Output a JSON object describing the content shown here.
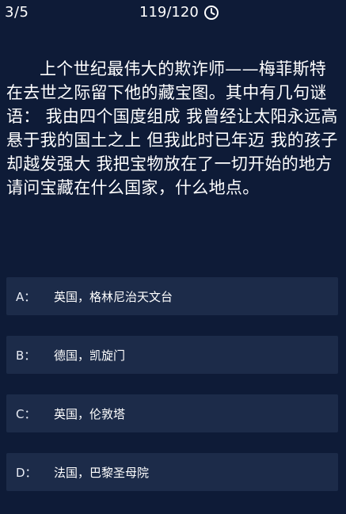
{
  "header": {
    "progress": "3/5",
    "timer": "119/120",
    "timer_icon": "clock-icon"
  },
  "question": {
    "text": "上个世纪最伟大的欺诈师——梅菲斯特在去世之际留下他的藏宝图。其中有几句谜语： 我由四个国度组成 我曾经让太阳永远高悬于我的国土之上 但我此时已年迈 我的孩子却越发强大 我把宝物放在了一切开始的地方 请问宝藏在什么国家，什么地点。"
  },
  "options": [
    {
      "key": "A：",
      "text": "英国，格林尼治天文台"
    },
    {
      "key": "B：",
      "text": "德国，凯旋门"
    },
    {
      "key": "C：",
      "text": "英国，伦敦塔"
    },
    {
      "key": "D：",
      "text": "法国，巴黎圣母院"
    }
  ],
  "colors": {
    "background": "#0e1b37",
    "option_background": "#1c2b49",
    "text": "#ffffff"
  }
}
